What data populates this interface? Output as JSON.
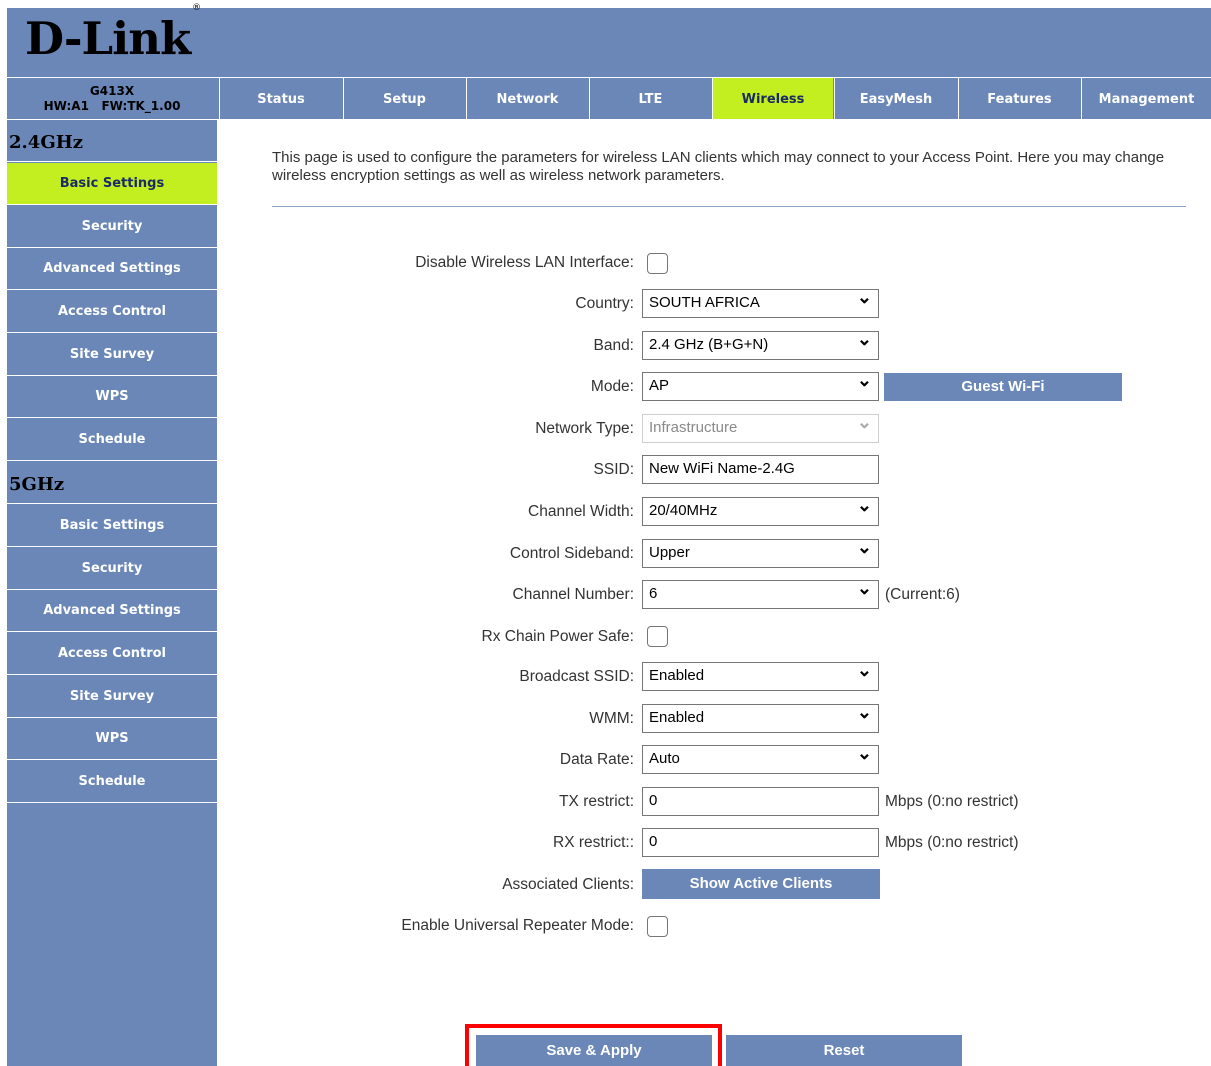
{
  "brand": {
    "logo_text": "D-Link",
    "registered_mark": "®"
  },
  "device": {
    "model": "G413X",
    "hw_fw": "HW:A1   FW:TK_1.00"
  },
  "tabs": [
    {
      "label": "Status",
      "active": false
    },
    {
      "label": "Setup",
      "active": false
    },
    {
      "label": "Network",
      "active": false
    },
    {
      "label": "LTE",
      "active": false
    },
    {
      "label": "Wireless",
      "active": true
    },
    {
      "label": "EasyMesh",
      "active": false
    },
    {
      "label": "Features",
      "active": false
    },
    {
      "label": "Management",
      "active": false
    }
  ],
  "sidebar": {
    "band_24": "2.4GHz",
    "band_5": "5GHz",
    "items_24": [
      "Basic Settings",
      "Security",
      "Advanced Settings",
      "Access Control",
      "Site Survey",
      "WPS",
      "Schedule"
    ],
    "items_5": [
      "Basic Settings",
      "Security",
      "Advanced Settings",
      "Access Control",
      "Site Survey",
      "WPS",
      "Schedule"
    ],
    "active": "2.4GHz Basic Settings"
  },
  "intro": "This page is used to configure the parameters for wireless LAN clients which may connect to your Access Point. Here you may change wireless encryption settings as well as wireless network parameters.",
  "form": {
    "disable_wlan": {
      "label": "Disable Wireless LAN Interface:",
      "checked": false
    },
    "country": {
      "label": "Country:",
      "value": "SOUTH AFRICA"
    },
    "band": {
      "label": "Band:",
      "value": "2.4 GHz (B+G+N)"
    },
    "mode": {
      "label": "Mode:",
      "value": "AP"
    },
    "guest_wifi_button": "Guest Wi-Fi",
    "network_type": {
      "label": "Network Type:",
      "value": "Infrastructure"
    },
    "ssid": {
      "label": "SSID:",
      "value": "New WiFi Name-2.4G"
    },
    "channel_width": {
      "label": "Channel Width:",
      "value": "20/40MHz"
    },
    "control_sideband": {
      "label": "Control Sideband:",
      "value": "Upper"
    },
    "channel_number": {
      "label": "Channel Number:",
      "value": "6",
      "current": "(Current:6)"
    },
    "rx_chain": {
      "label": "Rx Chain Power Safe:",
      "checked": false
    },
    "broadcast_ssid": {
      "label": "Broadcast SSID:",
      "value": "Enabled"
    },
    "wmm": {
      "label": "WMM:",
      "value": "Enabled"
    },
    "data_rate": {
      "label": "Data Rate:",
      "value": "Auto"
    },
    "tx_restrict": {
      "label": "TX restrict:",
      "value": "0",
      "unit": "Mbps (0:no restrict)"
    },
    "rx_restrict": {
      "label": "RX restrict::",
      "value": "0",
      "unit": "Mbps (0:no restrict)"
    },
    "associated_clients": {
      "label": "Associated Clients:",
      "button": "Show Active Clients"
    },
    "universal_repeater": {
      "label": "Enable Universal Repeater Mode:",
      "checked": false
    }
  },
  "actions": {
    "save": "Save & Apply",
    "reset": "Reset"
  },
  "colors": {
    "nav_blue": "#6a87b7",
    "active_green": "#c3ef20",
    "highlight_red": "#ff0000"
  }
}
